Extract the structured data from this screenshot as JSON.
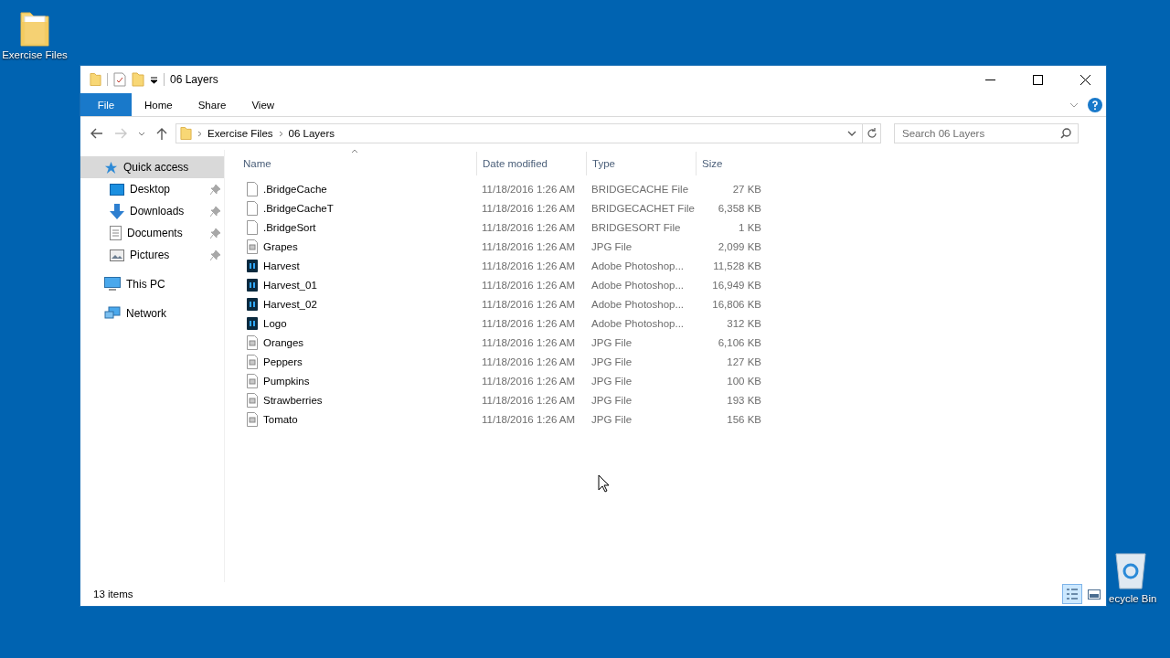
{
  "desktop_icons": [
    {
      "label": "Exercise Files",
      "kind": "folder"
    },
    {
      "label": "ecycle Bin",
      "kind": "bin"
    }
  ],
  "window": {
    "title": "06 Layers"
  },
  "ribbon_tabs": [
    {
      "label": "File",
      "kind": "file"
    },
    {
      "label": "Home",
      "kind": "tab"
    },
    {
      "label": "Share",
      "kind": "tab"
    },
    {
      "label": "View",
      "kind": "tab"
    }
  ],
  "address": {
    "crumbs": [
      "Exercise Files",
      "06 Layers"
    ]
  },
  "search": {
    "placeholder": "Search 06 Layers"
  },
  "sidebar": {
    "items": [
      {
        "label": "Quick access",
        "kind": "star",
        "selected": true,
        "children": [
          {
            "label": "Desktop",
            "kind": "desktop",
            "pinned": true,
            "selected": false
          },
          {
            "label": "Downloads",
            "kind": "downloads",
            "pinned": true,
            "selected": false
          },
          {
            "label": "Documents",
            "kind": "documents",
            "pinned": true,
            "selected": false
          },
          {
            "label": "Pictures",
            "kind": "pictures",
            "pinned": true,
            "selected": false
          }
        ]
      },
      {
        "label": "This PC",
        "kind": "pc",
        "selected": false
      },
      {
        "label": "Network",
        "kind": "network",
        "selected": false
      }
    ]
  },
  "table": {
    "columns": [
      "Name",
      "Date modified",
      "Type",
      "Size"
    ],
    "rows": [
      {
        "kind": "blank",
        "name": ".BridgeCache",
        "date": "11/18/2016 1:26 AM",
        "type": "BRIDGECACHE File",
        "size": "27 KB"
      },
      {
        "kind": "blank",
        "name": ".BridgeCacheT",
        "date": "11/18/2016 1:26 AM",
        "type": "BRIDGECACHET File",
        "size": "6,358 KB"
      },
      {
        "kind": "blank",
        "name": ".BridgeSort",
        "date": "11/18/2016 1:26 AM",
        "type": "BRIDGESORT File",
        "size": "1 KB"
      },
      {
        "kind": "image",
        "name": "Grapes",
        "date": "11/18/2016 1:26 AM",
        "type": "JPG File",
        "size": "2,099 KB"
      },
      {
        "kind": "psd",
        "name": "Harvest",
        "date": "11/18/2016 1:26 AM",
        "type": "Adobe Photoshop...",
        "size": "11,528 KB"
      },
      {
        "kind": "psd",
        "name": "Harvest_01",
        "date": "11/18/2016 1:26 AM",
        "type": "Adobe Photoshop...",
        "size": "16,949 KB"
      },
      {
        "kind": "psd",
        "name": "Harvest_02",
        "date": "11/18/2016 1:26 AM",
        "type": "Adobe Photoshop...",
        "size": "16,806 KB"
      },
      {
        "kind": "psd",
        "name": "Logo",
        "date": "11/18/2016 1:26 AM",
        "type": "Adobe Photoshop...",
        "size": "312 KB"
      },
      {
        "kind": "image",
        "name": "Oranges",
        "date": "11/18/2016 1:26 AM",
        "type": "JPG File",
        "size": "6,106 KB"
      },
      {
        "kind": "image",
        "name": "Peppers",
        "date": "11/18/2016 1:26 AM",
        "type": "JPG File",
        "size": "127 KB"
      },
      {
        "kind": "image",
        "name": "Pumpkins",
        "date": "11/18/2016 1:26 AM",
        "type": "JPG File",
        "size": "100 KB"
      },
      {
        "kind": "image",
        "name": "Strawberries",
        "date": "11/18/2016 1:26 AM",
        "type": "JPG File",
        "size": "193 KB"
      },
      {
        "kind": "image",
        "name": "Tomato",
        "date": "11/18/2016 1:26 AM",
        "type": "JPG File",
        "size": "156 KB"
      }
    ]
  },
  "status_bar": {
    "count": "13 items",
    "views": [
      {
        "kind": "details",
        "selected": true
      },
      {
        "kind": "large",
        "selected": false
      }
    ]
  }
}
